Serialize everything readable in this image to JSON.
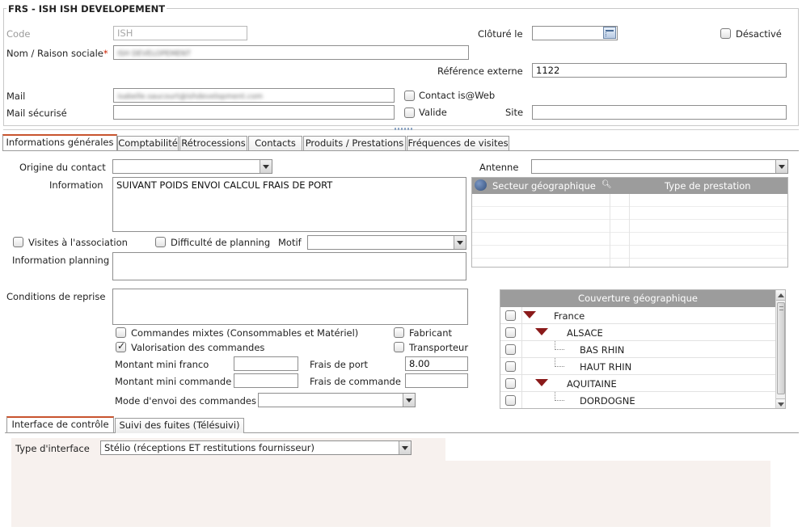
{
  "header": {
    "group_title": "FRS - ISH ISH DEVELOPEMENT",
    "code_label": "Code",
    "code_value": "ISH",
    "name_label": "Nom / Raison sociale",
    "required_mark": "*",
    "name_value": "ISH DEVELOPEMENT",
    "cloture_label": "Clôturé le",
    "cloture_value": "",
    "desactive_label": "Désactivé",
    "ref_label": "Référence externe",
    "ref_value": "1122",
    "mail_label": "Mail",
    "mail_value": "isabelle.saucourt@ishdevelopment.com",
    "contact_label": "Contact is@Web",
    "mail_secure_label": "Mail sécurisé",
    "mail_secure_value": "",
    "valide_label": "Valide",
    "site_label": "Site",
    "site_value": ""
  },
  "tabs": [
    {
      "label": "Informations générales"
    },
    {
      "label": "Comptabilité"
    },
    {
      "label": "Rétrocessions"
    },
    {
      "label": "Contacts"
    },
    {
      "label": "Produits / Prestations"
    },
    {
      "label": "Fréquences de visites"
    }
  ],
  "general": {
    "origine_label": "Origine du contact",
    "origine_value": "",
    "antenne_label": "Antenne",
    "antenne_value": "",
    "information_label": "Information",
    "information_value": "SUIVANT POIDS ENVOI CALCUL FRAIS DE PORT",
    "sector_grid": {
      "col1": "Secteur géographique",
      "col2": "Type de prestation"
    },
    "visites_label": "Visites à l'association",
    "difficulte_label": "Difficulté de planning",
    "motif_label": "Motif",
    "motif_value": "",
    "info_planning_label": "Information planning",
    "info_planning_value": "",
    "conditions_label": "Conditions de reprise",
    "conditions_value": "",
    "commandes_mixtes_label": "Commandes mixtes (Consommables et Matériel)",
    "fabricant_label": "Fabricant",
    "valorisation_label": "Valorisation des commandes",
    "valorisation_checked": true,
    "transporteur_label": "Transporteur",
    "montant_franco_label": "Montant mini franco",
    "montant_franco_value": "",
    "frais_port_label": "Frais de port",
    "frais_port_value": "8.00",
    "montant_commande_label": "Montant mini commande",
    "montant_commande_value": "",
    "frais_commande_label": "Frais de commande",
    "frais_commande_value": "",
    "mode_envoi_label": "Mode d'envoi des commandes",
    "mode_envoi_value": "",
    "coverage": {
      "title": "Couverture géographique",
      "rows": [
        {
          "label": "France",
          "level": 0,
          "expanded": true
        },
        {
          "label": "ALSACE",
          "level": 1,
          "expanded": true
        },
        {
          "label": "BAS RHIN",
          "level": 2,
          "expanded": false
        },
        {
          "label": "HAUT RHIN",
          "level": 2,
          "expanded": false
        },
        {
          "label": "AQUITAINE",
          "level": 1,
          "expanded": true
        },
        {
          "label": "DORDOGNE",
          "level": 2,
          "expanded": false
        }
      ]
    }
  },
  "bottom_tabs": [
    {
      "label": "Interface de contrôle"
    },
    {
      "label": "Suivi des fuites (Télésuivi)"
    }
  ],
  "interface": {
    "type_label": "Type d'interface",
    "type_value": "Stélio (réceptions ET restitutions fournisseur)"
  },
  "colors": {
    "accent": "#c8542e",
    "grid_header": "#9c9c9c",
    "panel_bg": "#f7f1ee",
    "tree_arrow": "#8a1a1a"
  },
  "icons": [
    "calendar-icon",
    "search-icon",
    "globe-icon",
    "chevron-down-icon",
    "expand-arrow-icon",
    "scroll-up-icon",
    "scroll-down-icon"
  ]
}
